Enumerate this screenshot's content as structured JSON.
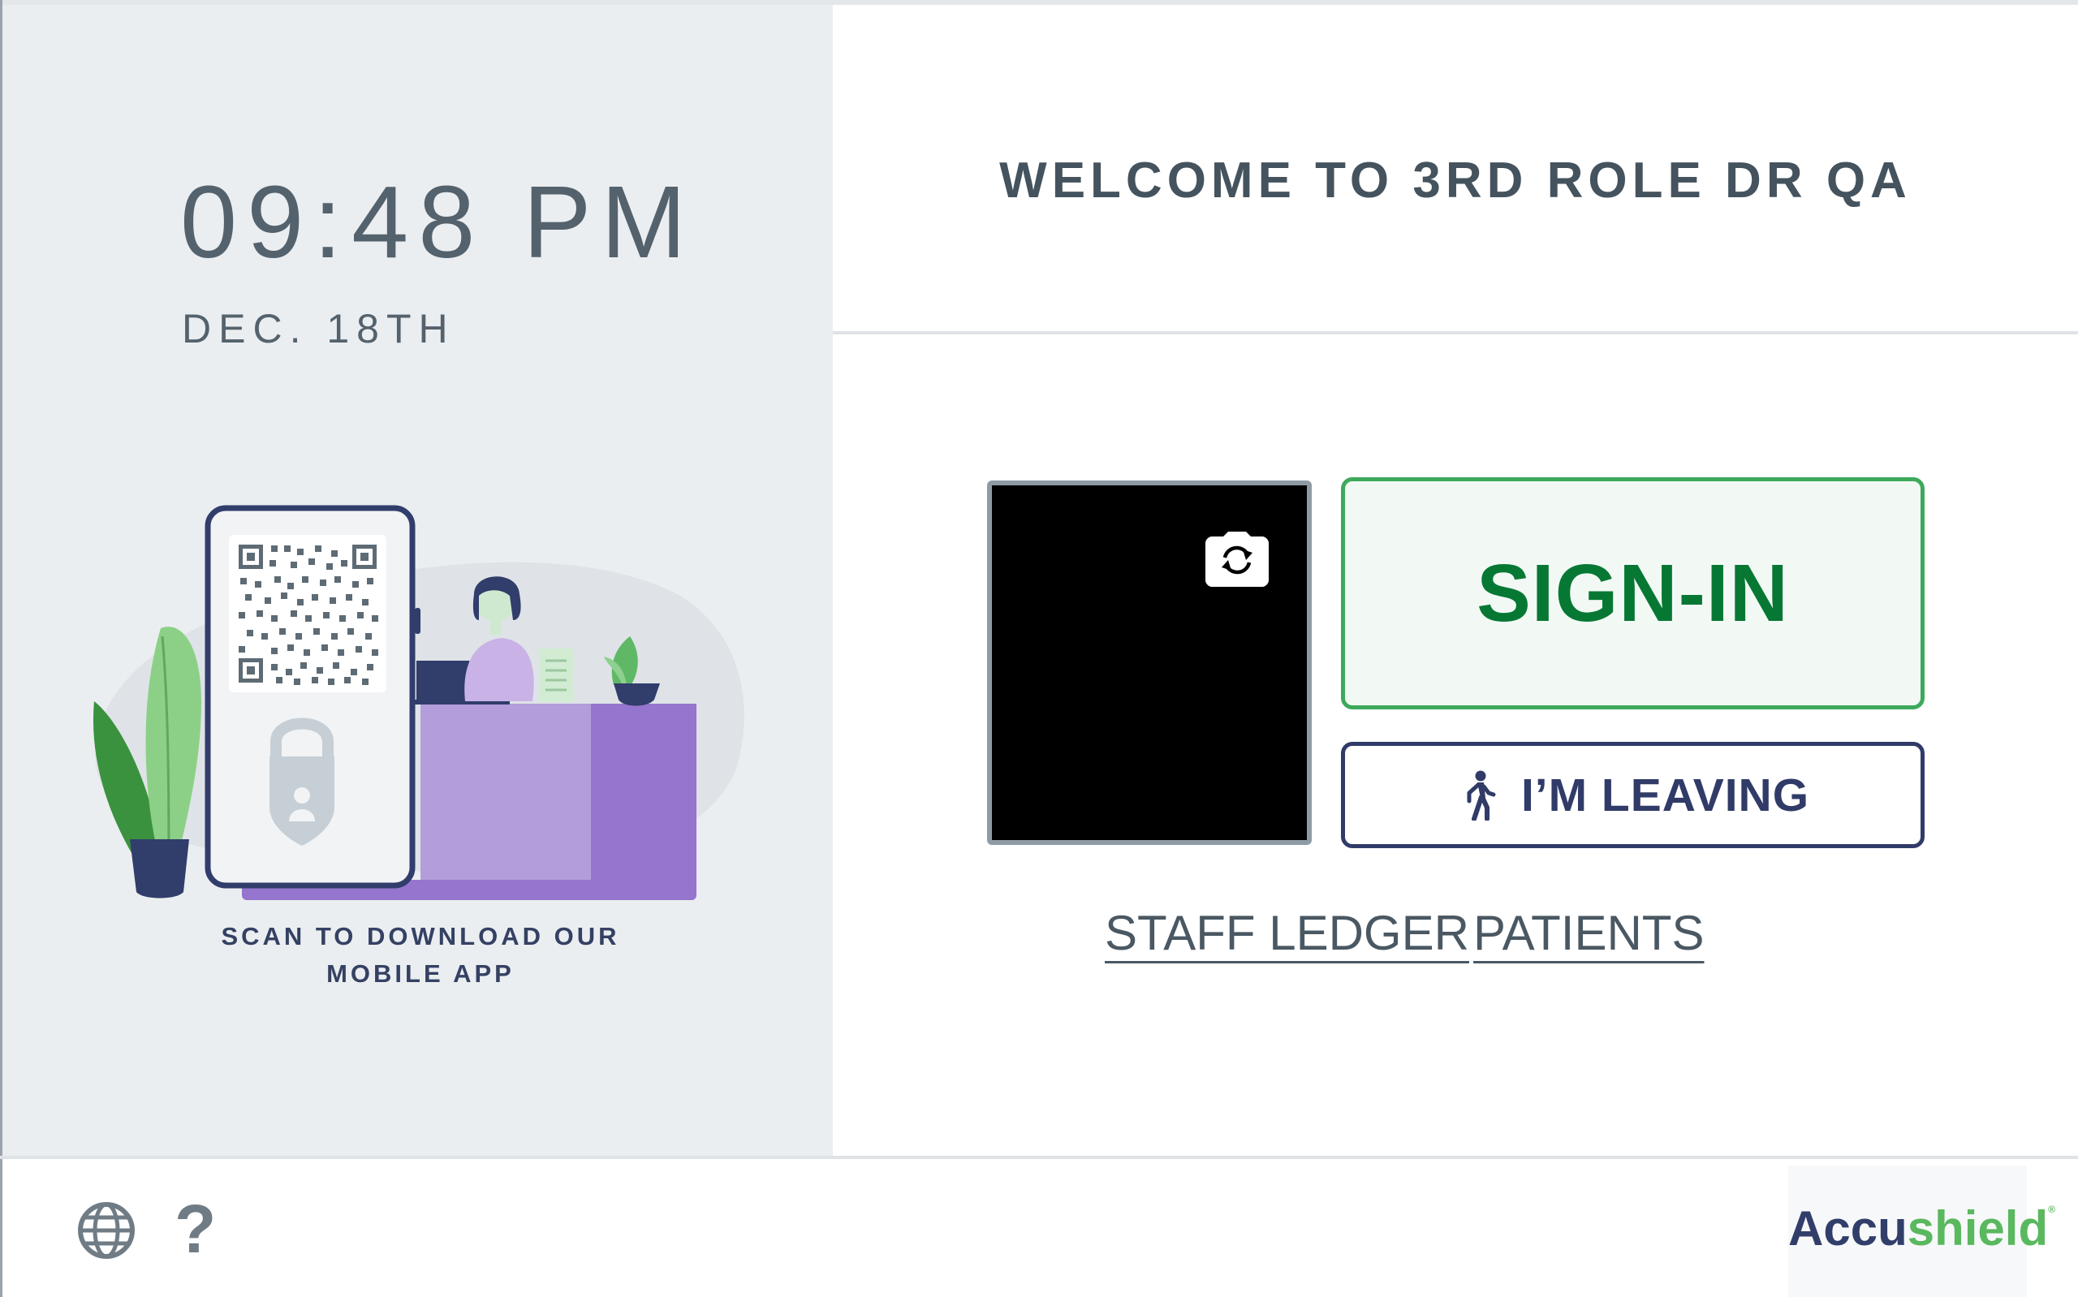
{
  "clock": {
    "time": "09:48 PM",
    "date": "DEC. 18TH"
  },
  "promo": {
    "line1": "SCAN TO DOWNLOAD OUR",
    "line2": "MOBILE APP"
  },
  "header": {
    "welcome": "WELCOME TO 3RD ROLE DR QA"
  },
  "actions": {
    "signin_label": "SIGN-IN",
    "leaving_label": "I’M LEAVING"
  },
  "links": {
    "staff_ledger": "STAFF LEDGER",
    "patients": "PATIENTS"
  },
  "footer": {
    "help_label": "?",
    "brand_part1": "Accu",
    "brand_part2": "shield",
    "brand_mark": "®"
  },
  "icons": {
    "camera_switch": "camera-switch-icon",
    "walking": "walking-person-icon",
    "globe": "globe-icon",
    "help": "question-mark-icon"
  },
  "colors": {
    "signin_green": "#077834",
    "signin_border": "#3da95b",
    "leaving_navy": "#303b68",
    "text_slate": "#54626d",
    "left_panel_bg": "#ebeef1",
    "brand_navy": "#323e6a",
    "brand_green": "#5ab85e"
  }
}
